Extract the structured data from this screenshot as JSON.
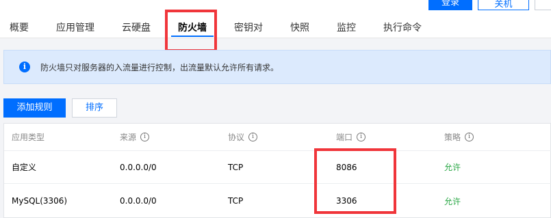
{
  "header": {
    "login_label": "登录",
    "shutdown_label": "关机",
    "tabs": [
      {
        "label": "概要"
      },
      {
        "label": "应用管理"
      },
      {
        "label": "云硬盘"
      },
      {
        "label": "防火墙"
      },
      {
        "label": "密钥对"
      },
      {
        "label": "快照"
      },
      {
        "label": "监控"
      },
      {
        "label": "执行命令"
      }
    ],
    "active_tab": "防火墙"
  },
  "notice": {
    "icon": "info-icon",
    "text": "防火墙只对服务器的入流量进行控制，出流量默认允许所有请求。"
  },
  "toolbar": {
    "add_rule_label": "添加规则",
    "sort_label": "排序"
  },
  "table": {
    "columns": [
      "应用类型",
      "来源",
      "协议",
      "端口",
      "策略"
    ],
    "rows": [
      {
        "type": "自定义",
        "source": "0.0.0.0/0",
        "protocol": "TCP",
        "port": "8086",
        "policy": "允许"
      },
      {
        "type": "MySQL(3306)",
        "source": "0.0.0.0/0",
        "protocol": "TCP",
        "port": "3306",
        "policy": "允许"
      }
    ]
  },
  "colors": {
    "accent": "#006eff",
    "highlight": "#f0353a",
    "allow": "#29a745",
    "notice_bg": "#dceafd"
  }
}
